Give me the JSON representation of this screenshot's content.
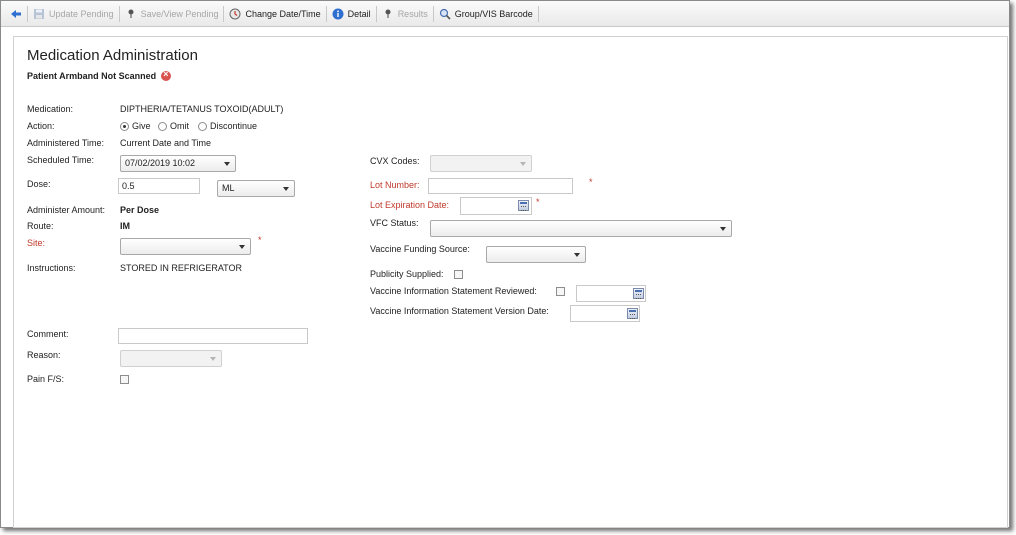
{
  "toolbar": {
    "update_pending": "Update Pending",
    "save_view_pending": "Save/View Pending",
    "change_date_time": "Change Date/Time",
    "detail": "Detail",
    "results": "Results",
    "group_vis_barcode": "Group/VIS Barcode"
  },
  "page": {
    "title": "Medication Administration",
    "armband_warning": "Patient Armband Not Scanned"
  },
  "left": {
    "medication_label": "Medication:",
    "medication_value": "DIPTHERIA/TETANUS TOXOID(ADULT)",
    "action_label": "Action:",
    "action_give": "Give",
    "action_omit": "Omit",
    "action_discontinue": "Discontinue",
    "action_selected": "Give",
    "administered_time_label": "Administered Time:",
    "administered_time_value": "Current Date and Time",
    "scheduled_time_label": "Scheduled Time:",
    "scheduled_time_value": "07/02/2019 10:02",
    "dose_label": "Dose:",
    "dose_value": "0.5",
    "dose_unit": "ML",
    "administer_amount_label": "Administer Amount:",
    "administer_amount_value": "Per Dose",
    "route_label": "Route:",
    "route_value": "IM",
    "site_label": "Site:",
    "site_value": "",
    "instructions_label": "Instructions:",
    "instructions_value": "STORED IN REFRIGERATOR",
    "comment_label": "Comment:",
    "comment_value": "",
    "reason_label": "Reason:",
    "reason_value": "",
    "pain_label": "Pain F/S:",
    "required_marker": "*"
  },
  "right": {
    "cvx_label": "CVX Codes:",
    "cvx_value": "",
    "lot_number_label": "Lot Number:",
    "lot_number_value": "",
    "lot_exp_label": "Lot Expiration Date:",
    "lot_exp_value": "",
    "vfc_label": "VFC Status:",
    "vfc_value": "",
    "funding_label": "Vaccine Funding Source:",
    "funding_value": "",
    "publicity_label": "Publicity Supplied:",
    "vis_reviewed_label": "Vaccine Information Statement Reviewed:",
    "vis_reviewed_date": "",
    "vis_version_label": "Vaccine Information Statement Version Date:",
    "vis_version_date": ""
  },
  "colors": {
    "required_label": "#c0392b",
    "warning_icon": "#d9534f",
    "toolbar_icon_blue": "#2f6fd0"
  }
}
